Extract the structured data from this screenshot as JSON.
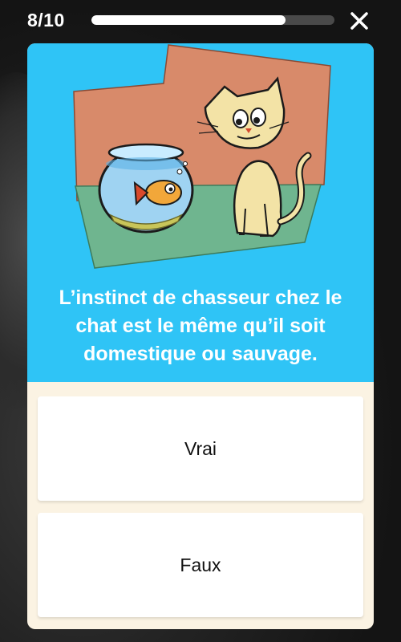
{
  "header": {
    "counter": "8/10",
    "progress_fraction": 0.8
  },
  "icons": {
    "close": "close-icon"
  },
  "question": {
    "text": "L’instinct de chasseur chez le chat est le même qu’il soit domestique ou sauvage."
  },
  "answers": [
    {
      "label": "Vrai"
    },
    {
      "label": "Faux"
    }
  ],
  "colors": {
    "card_top": "#2fc4f6",
    "card_bottom": "#fbf3e3",
    "progress_track": "#4a4a4a",
    "progress_fill": "#ffffff"
  }
}
